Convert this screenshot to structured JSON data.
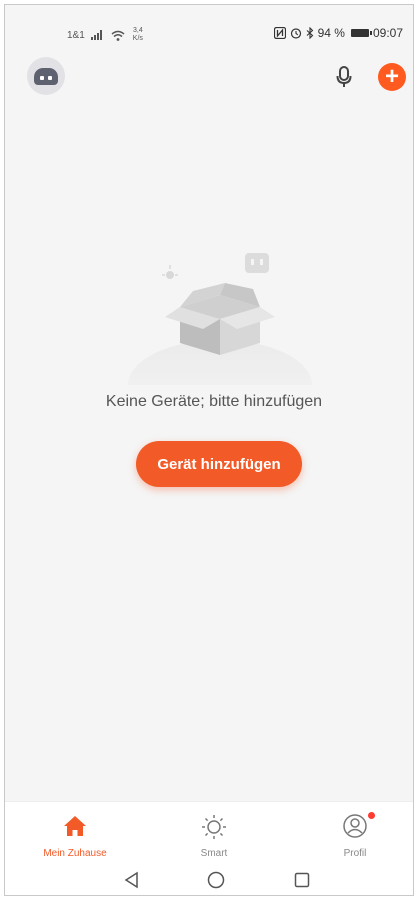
{
  "status_bar": {
    "carrier": "1&1",
    "speed_value": "3,4",
    "speed_unit": "K/s",
    "battery": "94 %",
    "time": "09:07"
  },
  "top_bar": {
    "avatar_icon": "robot-avatar-icon",
    "mic_icon": "microphone-icon",
    "add_icon": "plus-icon",
    "add_label": "+"
  },
  "empty_state": {
    "message": "Keine Geräte; bitte hinzufügen",
    "button_label": "Gerät hinzufügen"
  },
  "tabs": [
    {
      "label": "Mein Zuhause",
      "icon": "home-icon",
      "active": true
    },
    {
      "label": "Smart",
      "icon": "sun-icon",
      "active": false
    },
    {
      "label": "Profil",
      "icon": "profile-icon",
      "active": false,
      "badge": true
    }
  ],
  "colors": {
    "accent": "#f25a28",
    "background": "#f5f5f5",
    "tab_inactive": "#888888",
    "badge": "#ff3a30"
  }
}
